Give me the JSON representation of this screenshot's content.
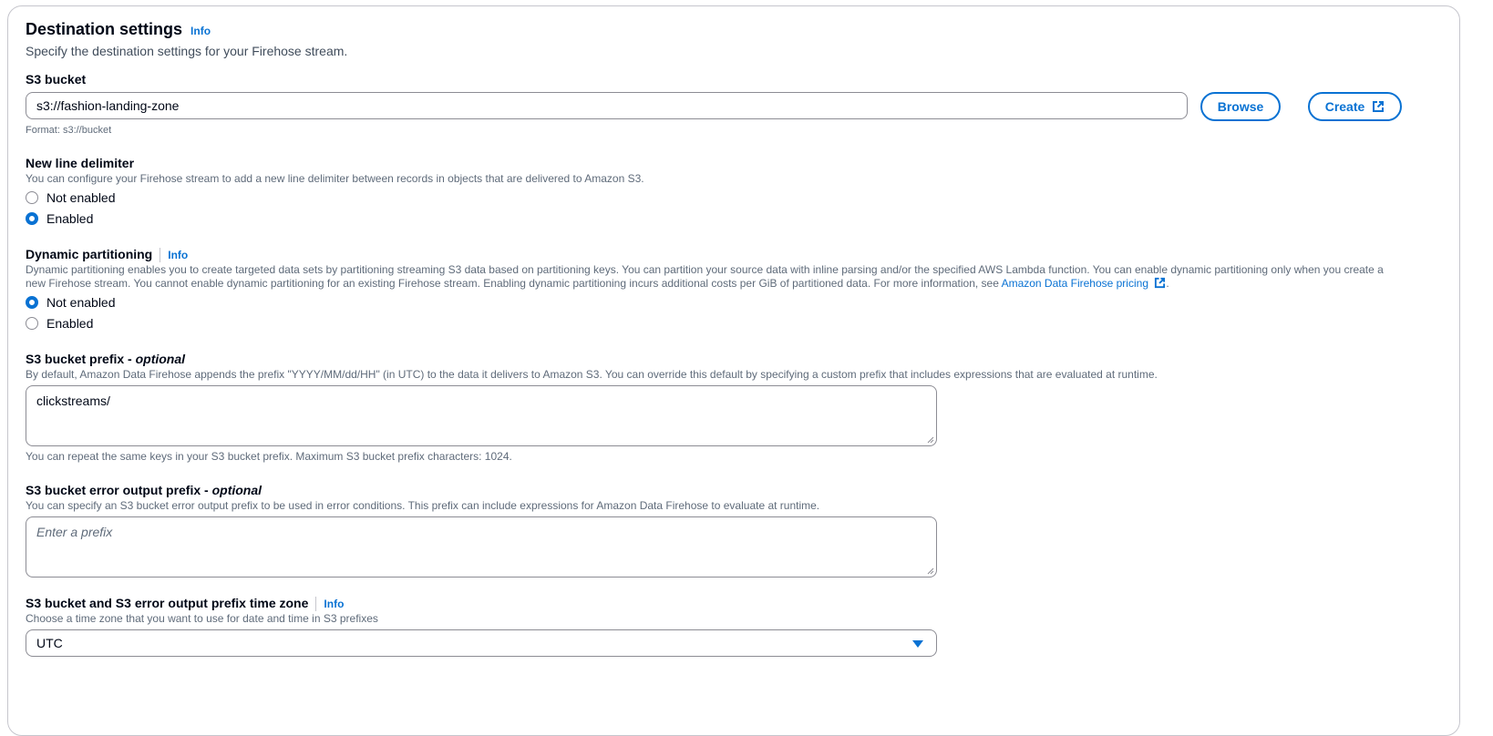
{
  "section": {
    "title": "Destination settings",
    "info": "Info",
    "description": "Specify the destination settings for your Firehose stream."
  },
  "s3_bucket": {
    "label": "S3 bucket",
    "value": "s3://fashion-landing-zone",
    "hint": "Format: s3://bucket",
    "browse_label": "Browse",
    "create_label": "Create",
    "create_icon": "external-link-icon"
  },
  "new_line_delimiter": {
    "label": "New line delimiter",
    "description": "You can configure your Firehose stream to add a new line delimiter between records in objects that are delivered to Amazon S3.",
    "options": [
      "Not enabled",
      "Enabled"
    ],
    "selected": "Enabled"
  },
  "dynamic_partitioning": {
    "label": "Dynamic partitioning",
    "info": "Info",
    "description_line1": "Dynamic partitioning enables you to create targeted data sets by partitioning streaming S3 data based on partitioning keys. You can partition your source data with inline parsing and/or the specified AWS Lambda function. You can enable dynamic partitioning only when you create a",
    "description_line2": "new Firehose stream. You cannot enable dynamic partitioning for an existing Firehose stream. Enabling dynamic partitioning incurs additional costs per GiB of partitioned data. For more information, see ",
    "pricing_link": "Amazon Data Firehose pricing",
    "options": [
      "Not enabled",
      "Enabled"
    ],
    "selected": "Not enabled"
  },
  "s3_prefix": {
    "label": "S3 bucket prefix - ",
    "label_optional": "optional",
    "description": "By default, Amazon Data Firehose appends the prefix \"YYYY/MM/dd/HH\" (in UTC) to the data it delivers to Amazon S3. You can override this default by specifying a custom prefix that includes expressions that are evaluated at runtime.",
    "value": "clickstreams/",
    "hint": "You can repeat the same keys in your S3 bucket prefix. Maximum S3 bucket prefix characters: 1024."
  },
  "s3_error_prefix": {
    "label": "S3 bucket error output prefix - ",
    "label_optional": "optional",
    "description": "You can specify an S3 bucket error output prefix to be used in error conditions. This prefix can include expressions for Amazon Data Firehose to evaluate at runtime.",
    "placeholder": "Enter a prefix"
  },
  "time_zone": {
    "label": "S3 bucket and S3 error output prefix time zone",
    "info": "Info",
    "description": "Choose a time zone that you want to use for date and time in S3 prefixes",
    "value": "UTC"
  },
  "colors": {
    "accent": "#0972d3",
    "border": "#8c8c94",
    "text": "#000716",
    "secondary_text": "#414d5c"
  }
}
